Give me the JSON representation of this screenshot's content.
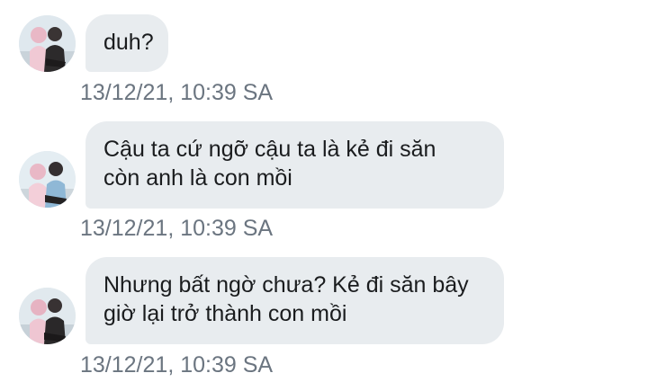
{
  "messages": [
    {
      "avatar_icon": "user-avatar",
      "lines": [
        "duh?"
      ],
      "timestamp": "13/12/21, 10:39 SA"
    },
    {
      "avatar_icon": "user-avatar",
      "lines": [
        "Cậu ta cứ ngỡ cậu ta là kẻ đi săn",
        "còn anh là con mồi"
      ],
      "timestamp": "13/12/21, 10:39 SA"
    },
    {
      "avatar_icon": "user-avatar",
      "lines": [
        "Nhưng bất ngờ chưa? Kẻ đi săn bây",
        "giờ lại trở thành con mồi"
      ],
      "timestamp": "13/12/21, 10:39 SA"
    }
  ],
  "colors": {
    "bubble_bg": "#e8ecef",
    "text": "#1a1c1e",
    "timestamp": "#6b7580"
  }
}
